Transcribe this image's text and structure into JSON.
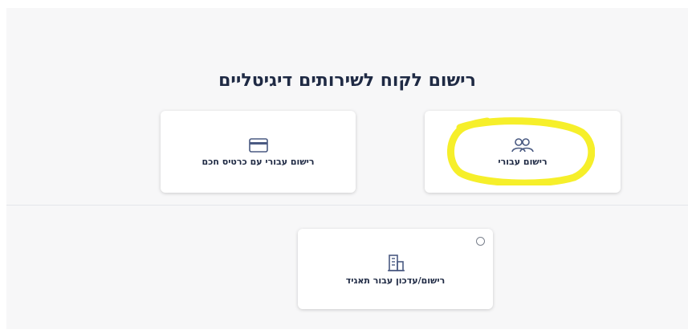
{
  "page": {
    "title": "רישום לקוח לשירותים דיגיטליים"
  },
  "cards": {
    "smart_card": {
      "label": "רישום עבורי עם כרטיס חכם",
      "icon": "credit-card-icon"
    },
    "personal": {
      "label": "רישום עבורי",
      "icon": "users-icon"
    },
    "corporate": {
      "label": "רישום/עדכון עבור תאגיד",
      "icon": "building-icon"
    }
  },
  "colors": {
    "text": "#1f2a44",
    "icon": "#4a5a82",
    "highlight": "#f6ef2a",
    "background": "#f7f7f8"
  }
}
